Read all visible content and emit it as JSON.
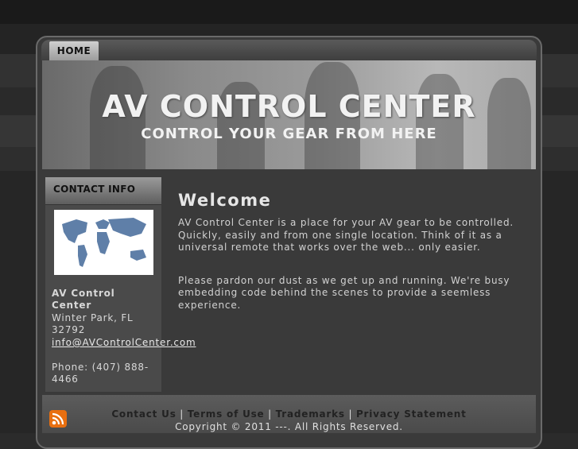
{
  "nav": {
    "home_label": "HOME"
  },
  "banner": {
    "title": "AV CONTROL CENTER",
    "subtitle": "CONTROL YOUR GEAR FROM HERE"
  },
  "sidebar": {
    "heading": "CONTACT INFO",
    "company_line1": "AV Control",
    "company_line2": "Center",
    "city": "Winter Park, FL",
    "zip": "32792",
    "email": "info@AVControlCenter.com",
    "phone_line1": "Phone: (407) 888-",
    "phone_line2": "4466"
  },
  "main": {
    "heading": "Welcome",
    "para1_l1": "AV Control Center is a place for your AV gear to be controlled.",
    "para1_l2": "Quickly, easily and from one single location. Think of it as a",
    "para1_l3": "universal remote that works over the web... only easier.",
    "para2_l1": "Please pardon our dust as we get up and running. We're busy",
    "para2_l2": "embedding code behind the scenes to provide a seemless",
    "para2_l3": "experience."
  },
  "footer": {
    "links": [
      "Contact Us",
      "Terms of Use",
      "Trademarks",
      "Privacy Statement"
    ],
    "separator": "|",
    "copyright": "Copyright © 2011 ---. All Rights Reserved.",
    "rss_icon": "rss-icon"
  },
  "colors": {
    "accent_rss": "#e86f10"
  }
}
